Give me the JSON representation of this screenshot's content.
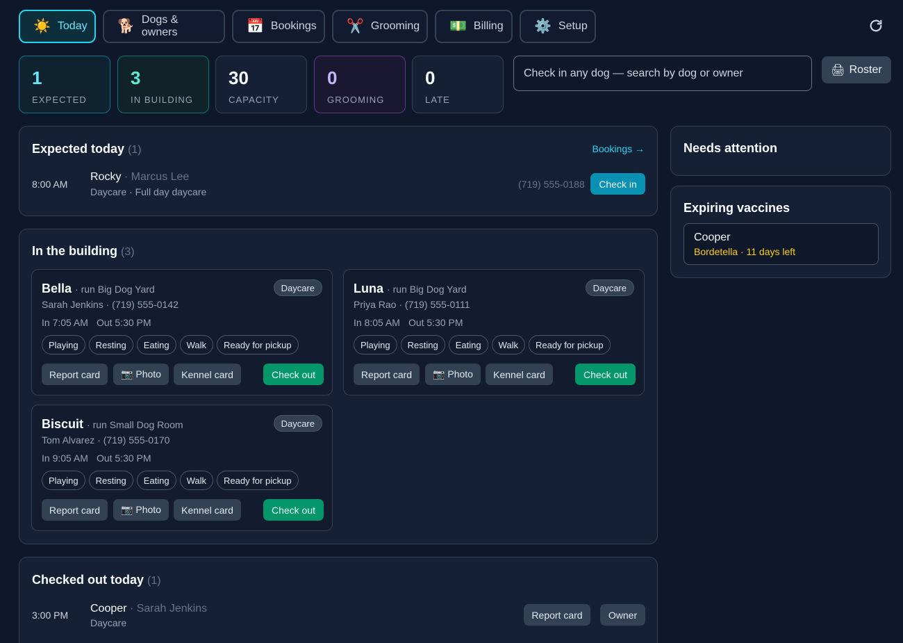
{
  "nav": {
    "tabs": [
      {
        "icon": "☀️",
        "icon_name": "sun-icon",
        "label": "Today",
        "active": true
      },
      {
        "icon": "🐕",
        "icon_name": "dog-icon",
        "label": "Dogs & owners"
      },
      {
        "icon": "📅",
        "icon_name": "calendar-icon",
        "label": "Bookings"
      },
      {
        "icon": "✂️",
        "icon_name": "scissors-icon",
        "label": "Grooming"
      },
      {
        "icon": "💵",
        "icon_name": "money-icon",
        "label": "Billing"
      },
      {
        "icon": "⚙️",
        "icon_name": "gear-icon",
        "label": "Setup"
      }
    ]
  },
  "stats": [
    {
      "value": "1",
      "label": "EXPECTED"
    },
    {
      "value": "3",
      "label": "IN BUILDING"
    },
    {
      "value": "30",
      "label": "CAPACITY"
    },
    {
      "value": "0",
      "label": "GROOMING"
    },
    {
      "value": "0",
      "label": "LATE"
    }
  ],
  "search": {
    "placeholder": "Check in any dog — search by dog or owner"
  },
  "roster": {
    "icon": "🖨",
    "label": "Roster"
  },
  "expected": {
    "title": "Expected today",
    "count": "(1)",
    "link": "Bookings →",
    "items": [
      {
        "time": "8:00 AM",
        "dog": "Rocky",
        "owner": "· Marcus Lee",
        "service": "Daycare · Full day daycare",
        "phone": "(719) 555-0188",
        "action": "Check in"
      }
    ]
  },
  "in_building": {
    "title": "In the building",
    "count": "(3)",
    "dogs": [
      {
        "name": "Bella",
        "run": "· run Big Dog Yard",
        "badge": "Daycare",
        "owner": "Sarah Jenkins · (719) 555-0142",
        "in": "In 7:05 AM",
        "out": "Out 5:30 PM"
      },
      {
        "name": "Luna",
        "run": "· run Big Dog Yard",
        "badge": "Daycare",
        "owner": "Priya Rao · (719) 555-0111",
        "in": "In 8:05 AM",
        "out": "Out 5:30 PM"
      },
      {
        "name": "Biscuit",
        "run": "· run Small Dog Room",
        "badge": "Daycare",
        "owner": "Tom Alvarez · (719) 555-0170",
        "in": "In 9:05 AM",
        "out": "Out 5:30 PM"
      }
    ],
    "chips": [
      "Playing",
      "Resting",
      "Eating",
      "Walk",
      "Ready for pickup"
    ],
    "actions": {
      "report": "Report card",
      "photo": "📷 Photo",
      "kennel": "Kennel card",
      "checkout": "Check out"
    }
  },
  "checked_out": {
    "title": "Checked out today",
    "count": "(1)",
    "items": [
      {
        "time": "3:00 PM",
        "dog": "Cooper",
        "owner": "· Sarah Jenkins",
        "service": "Daycare",
        "report": "Report card",
        "owner_btn": "Owner"
      }
    ]
  },
  "attention": {
    "title": "Needs attention"
  },
  "vaccines": {
    "title": "Expiring vaccines",
    "items": [
      {
        "dog": "Cooper",
        "info": "Bordetella · 11 days left"
      }
    ]
  },
  "colors": {
    "accent": "#22d3ee",
    "success": "#059669",
    "warning": "#facc15",
    "background": "#0f172a"
  }
}
